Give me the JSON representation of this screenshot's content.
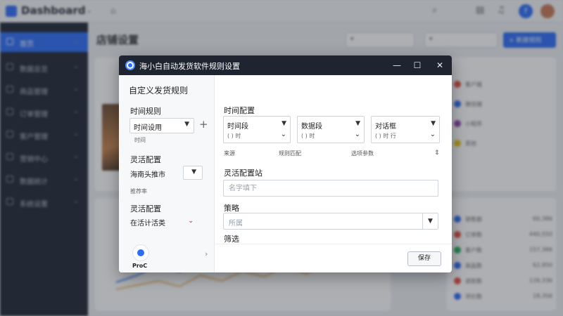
{
  "dashboard": {
    "brand": "Dashboard",
    "page_title": "店铺设置",
    "sidebar_items": [
      {
        "label": "首页"
      },
      {
        "label": "数据总览"
      },
      {
        "label": "商品管理"
      },
      {
        "label": "订单管理"
      },
      {
        "label": "客户管理"
      },
      {
        "label": "营销中心"
      },
      {
        "label": "数据统计"
      },
      {
        "label": "系统设置"
      }
    ],
    "new_button": "+ 新建规则",
    "notification_count": "3",
    "right_list": [
      {
        "label": "客户端",
        "value": "",
        "color": "#e74c3c"
      },
      {
        "label": "微信端",
        "value": "",
        "color": "#2d6df6"
      },
      {
        "label": "小程序",
        "value": "",
        "color": "#8e44ad"
      },
      {
        "label": "其他",
        "value": "",
        "color": "#f1c40f"
      }
    ],
    "stats_list": [
      {
        "label": "销售额",
        "value": "60,386",
        "color": "#2d6df6"
      },
      {
        "label": "订单数",
        "value": "440,550",
        "color": "#e74c3c"
      },
      {
        "label": "客户数",
        "value": "157,386",
        "color": "#27ae60"
      },
      {
        "label": "商品数",
        "value": "62,950",
        "color": "#2d6df6"
      },
      {
        "label": "退款数",
        "value": "126,336",
        "color": "#e74c3c"
      },
      {
        "label": "评价数",
        "value": "18,356",
        "color": "#2d6df6"
      }
    ]
  },
  "dialog": {
    "title": "海小白自动发货软件规则设置",
    "controls": {
      "minimize": "—",
      "maximize": "☐",
      "close": "✕"
    },
    "left": {
      "heading": "自定义发货规则",
      "section1_label": "时间规则",
      "section1_combo": "时间设用",
      "section1_sub": "时间",
      "section2_label": "灵活配置",
      "section2_combo": "海南头推市",
      "section2_sub": "推荐率",
      "section3_label": "灵活配置",
      "section3_combo": "在活计活类",
      "promo_text": "ProC"
    },
    "right": {
      "time_heading": "时间配置",
      "time_combos": [
        {
          "title": "时间段",
          "sub": "( )    时"
        },
        {
          "title": "数据段",
          "sub": "( )    时"
        },
        {
          "title": "对话框",
          "sub": "( )    时    行"
        }
      ],
      "captions": [
        "来源",
        "规则匹配",
        "选项参数"
      ],
      "flex_heading": "灵活配置站",
      "flex_placeholder": "名字填下",
      "select_heading": "策略",
      "select_value": "所属",
      "bottom_heading": "筛选",
      "save_label": "保存"
    }
  }
}
